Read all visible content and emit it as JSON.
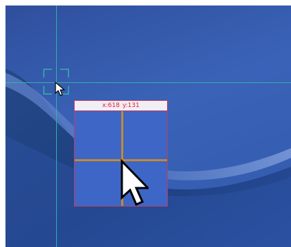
{
  "desktop": {
    "background_colors": [
      "#2f4f9d",
      "#3a63b8",
      "#1f3f86"
    ],
    "guide_color": "#31b3a6"
  },
  "magnifier": {
    "coords": {
      "x_label": "x:618",
      "y_label": "y:131"
    },
    "border_color": "#c43d5c",
    "text_color": "#e2232c",
    "crosshair_color": "#c38a33"
  },
  "cursor": {
    "icon": "arrow-cursor-icon"
  }
}
